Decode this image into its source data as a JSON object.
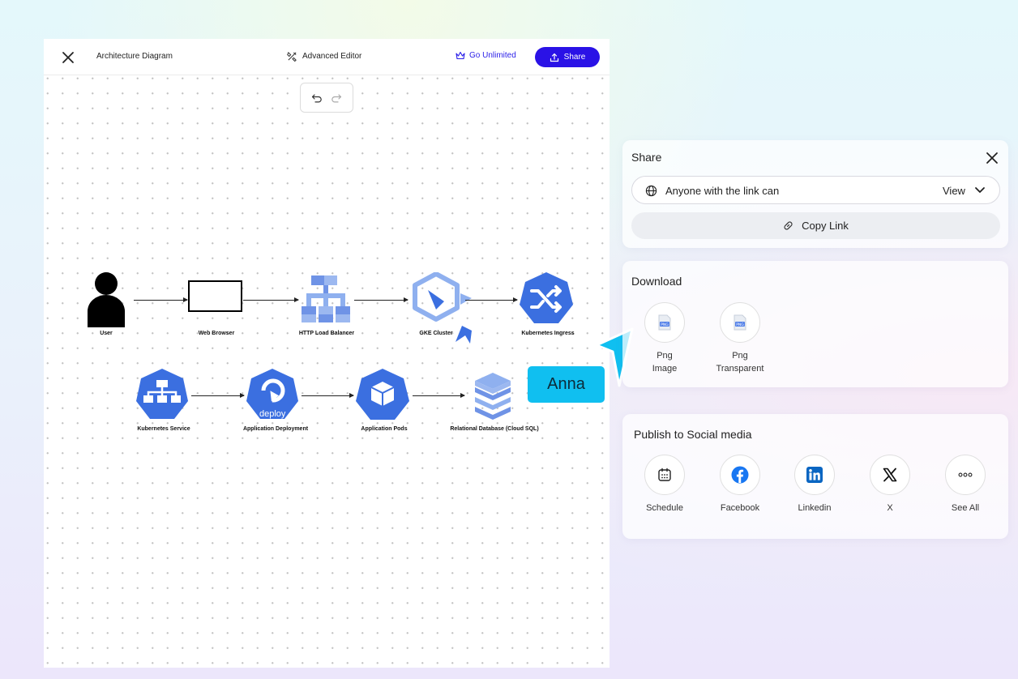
{
  "editor": {
    "title": "Architecture Diagram",
    "advanced_editor": "Advanced Editor",
    "go_unlimited": "Go Unlimited",
    "share": "Share"
  },
  "diagram": {
    "nodes": {
      "user": "User",
      "web_browser": "Web Browser",
      "http_lb": "HTTP Load Balancer",
      "gke": "GKE Cluster",
      "k8s_ingress": "Kubernetes Ingress",
      "k8s_service": "Kubernetes Service",
      "app_deploy": "Application Deployment",
      "app_pods": "Application Pods",
      "rel_db": "Relational Database (Cloud SQL)"
    },
    "deploy_text": "deploy",
    "collaborator": "Anna"
  },
  "share_panel": {
    "title": "Share",
    "access_text": "Anyone with the link can",
    "access_value": "View",
    "copy_link": "Copy Link"
  },
  "download_panel": {
    "title": "Download",
    "items": [
      {
        "line1": "Png",
        "line2": "Image",
        "badge": "PNG"
      },
      {
        "line1": "Png",
        "line2": "Transparent",
        "badge": "PNG"
      }
    ]
  },
  "social_panel": {
    "title": "Publish to Social media",
    "items": [
      {
        "label": "Schedule",
        "icon": "calendar-icon"
      },
      {
        "label": "Facebook",
        "icon": "facebook-icon"
      },
      {
        "label": "Linkedin",
        "icon": "linkedin-icon"
      },
      {
        "label": "X",
        "icon": "x-icon"
      },
      {
        "label": "See All",
        "icon": "more-icon"
      }
    ]
  },
  "colors": {
    "accent": "#2a12e6",
    "diagram_blue": "#3b6fe0",
    "light_blue": "#8fb0ef",
    "collab": "#10bff0"
  }
}
